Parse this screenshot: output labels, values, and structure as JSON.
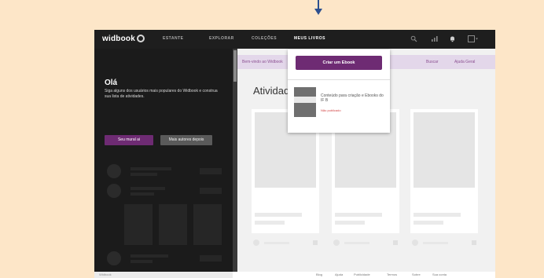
{
  "header": {
    "logo": "widbook",
    "nav": [
      "ESTANTE",
      "EXPLORAR",
      "COLEÇÕES",
      "MEUS LIVROS"
    ]
  },
  "sidebar": {
    "greeting": "Olá",
    "intro": "Siga alguns dos usuários mais populares do Widbook e construa sua lista de atividades.",
    "start_button": "Seu mural ai",
    "other_button": "Mais autores depois"
  },
  "main": {
    "bar_text": "Bem-vindo ao Widbook",
    "bar_links": [
      "Buscar",
      "Ajuda Geral"
    ],
    "section_title": "Atividade"
  },
  "dropdown": {
    "create_label": "Criar um Ebook",
    "book_title": "Conteúdo para criação e Ebooks do IF B",
    "book_status": "Não publicado"
  },
  "statusbar": {
    "left_text": "Widbook",
    "links": [
      "Blog",
      "Ajuda",
      "Publicidade",
      "Termos",
      "Sobre",
      "Sua conta"
    ]
  },
  "colors": {
    "brand_purple": "#6e2b73",
    "topbar": "#1e1e1e",
    "sidebar": "#1b1b1b",
    "page_background": "#fde6c8",
    "arrow": "#2c4f8f"
  }
}
